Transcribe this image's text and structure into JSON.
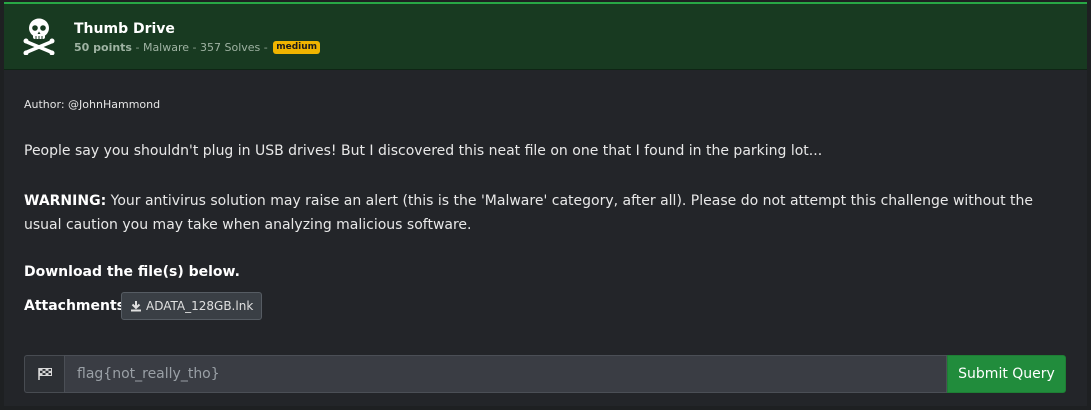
{
  "challenge": {
    "title": "Thumb Drive",
    "points": "50 points",
    "meta_sep1": " - ",
    "category": "Malware",
    "meta_sep2": " - ",
    "solves": "357 Solves",
    "meta_sep3": " - ",
    "difficulty": "medium",
    "difficulty_color": "#f0b400",
    "icon": "skull-crossbones-icon"
  },
  "body": {
    "author": "Author: @JohnHammond",
    "description": "People say you shouldn't plug in USB drives! But I discovered this neat file on one that I found in the parking lot...",
    "warning_label": "WARNING:",
    "warning_text": " Your antivirus solution may raise an alert (this is the 'Malware' category, after all). Please do not attempt this challenge without the usual caution you may take when analyzing malicious software.",
    "download_text": "Download the file(s) below.",
    "attachments_label": "Attachments:",
    "attachment_file": "ADATA_128GB.lnk",
    "attachment_icon": "download-icon"
  },
  "flag_form": {
    "flag_icon": "checkered-flag-icon",
    "placeholder": "flag{not_really_tho}",
    "value": "",
    "submit_label": "Submit Query"
  },
  "colors": {
    "accent": "#28a745",
    "header_bg": "#183a21",
    "submit_bg": "#218c3c"
  }
}
